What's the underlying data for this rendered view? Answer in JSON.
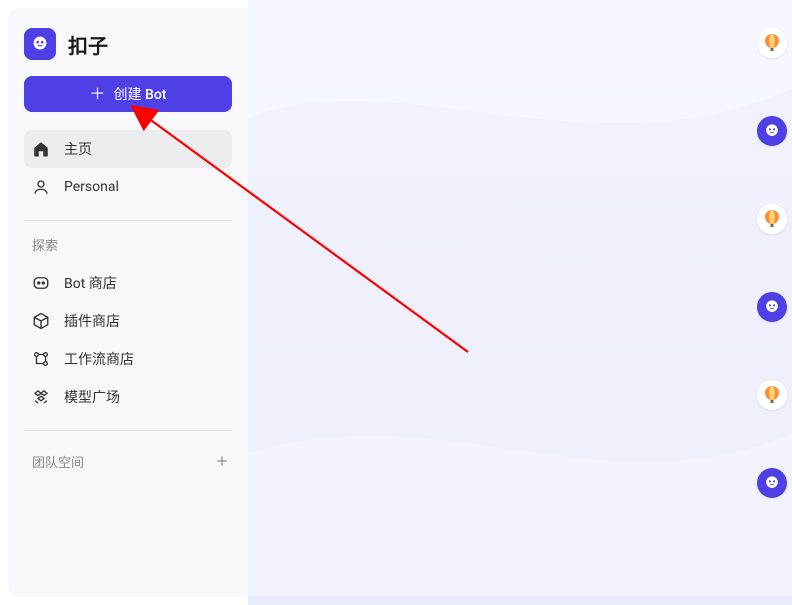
{
  "brand": {
    "name": "扣子"
  },
  "sidebar": {
    "create_label": "创建 Bot",
    "nav": [
      {
        "label": "主页",
        "icon": "home-icon",
        "active": true
      },
      {
        "label": "Personal",
        "icon": "user-icon",
        "active": false
      }
    ],
    "explore_label": "探索",
    "explore": [
      {
        "label": "Bot 商店",
        "icon": "bot-face-icon"
      },
      {
        "label": "插件商店",
        "icon": "cube-icon"
      },
      {
        "label": "工作流商店",
        "icon": "flow-icon"
      },
      {
        "label": "模型广场",
        "icon": "models-icon"
      }
    ],
    "team_label": "团队空间"
  },
  "right_rail": {
    "avatars": [
      "balloon",
      "bot",
      "balloon",
      "bot",
      "balloon",
      "bot"
    ]
  },
  "colors": {
    "accent": "#4e40e5",
    "annotation": "#ff0000"
  }
}
